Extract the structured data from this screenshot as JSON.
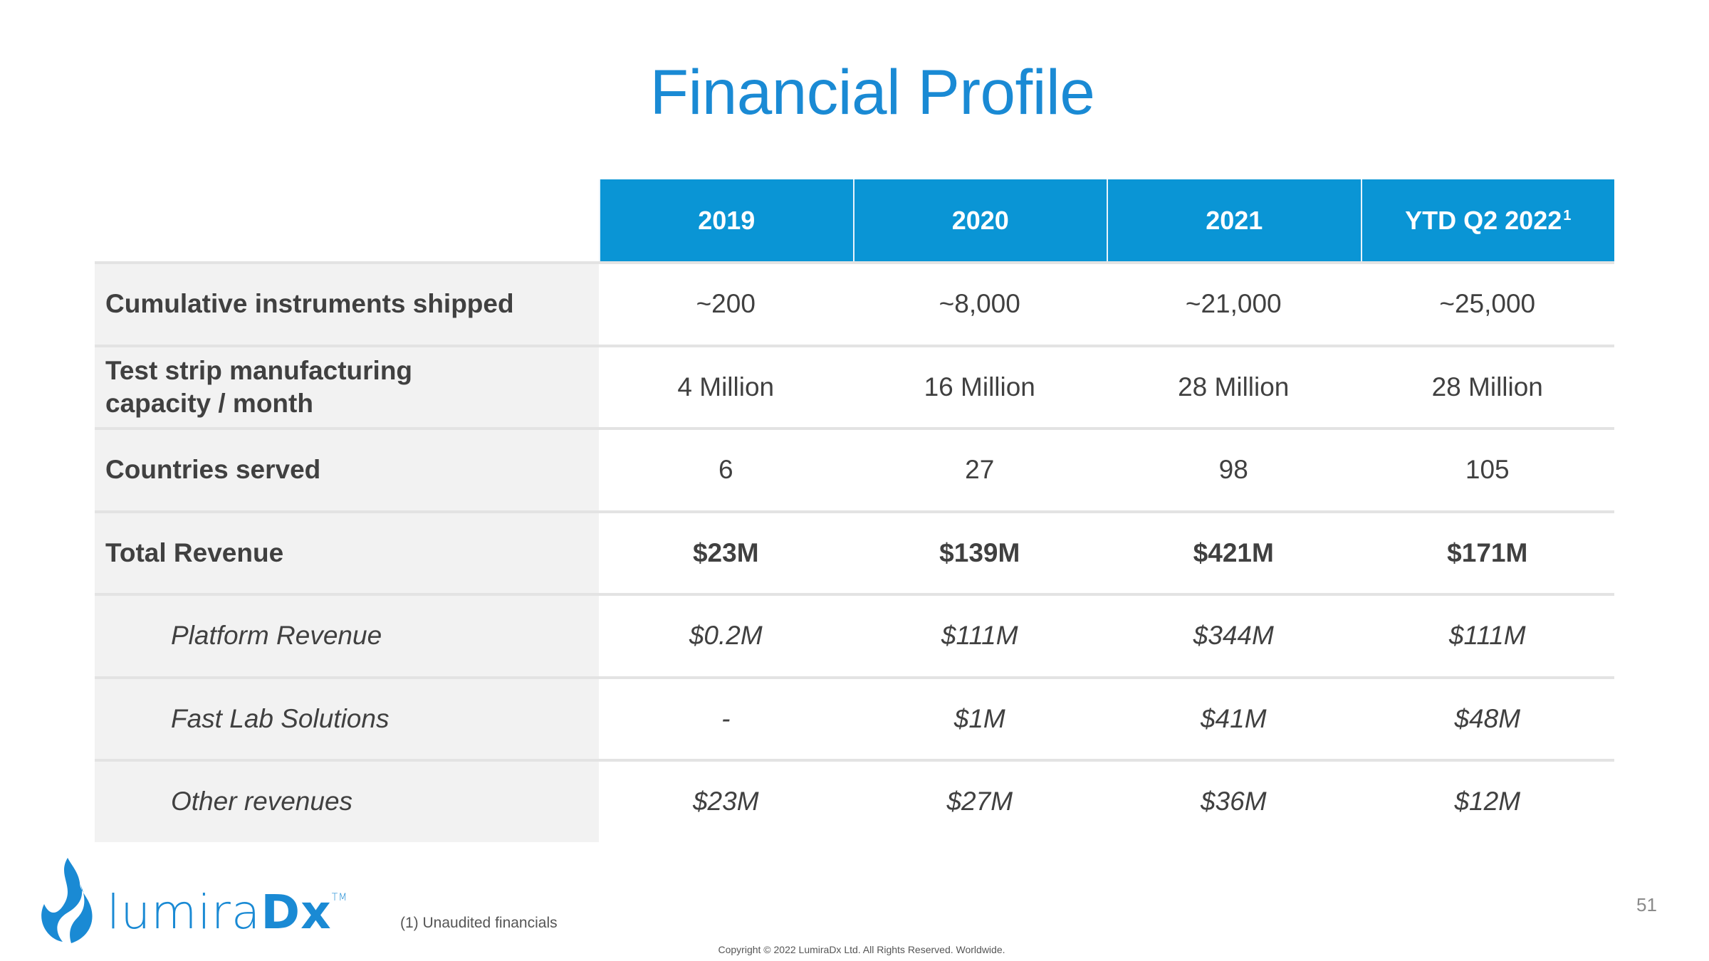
{
  "title": "Financial Profile",
  "table": {
    "columns": [
      {
        "label": "2019",
        "sup": ""
      },
      {
        "label": "2020",
        "sup": ""
      },
      {
        "label": "2021",
        "sup": ""
      },
      {
        "label": "YTD Q2 2022",
        "sup": "1"
      }
    ],
    "rows": [
      {
        "label": "Cumulative instruments shipped",
        "style": "bold-label",
        "values": [
          "~200",
          "~8,000",
          "~21,000",
          "~25,000"
        ]
      },
      {
        "label": "Test strip manufacturing capacity / month",
        "style": "bold-label",
        "values": [
          "4 Million",
          "16 Million",
          "28 Million",
          "28 Million"
        ]
      },
      {
        "label": "Countries served",
        "style": "bold-label",
        "values": [
          "6",
          "27",
          "98",
          "105"
        ]
      },
      {
        "label": "Total Revenue",
        "style": "bold",
        "values": [
          "$23M",
          "$139M",
          "$421M",
          "$171M"
        ]
      },
      {
        "label": "Platform Revenue",
        "style": "italic",
        "values": [
          "$0.2M",
          "$111M",
          "$344M",
          "$111M"
        ]
      },
      {
        "label": "Fast Lab Solutions",
        "style": "italic",
        "values": [
          "-",
          "$1M",
          "$41M",
          "$48M"
        ]
      },
      {
        "label": "Other revenues",
        "style": "italic",
        "values": [
          "$23M",
          "$27M",
          "$36M",
          "$12M"
        ]
      }
    ]
  },
  "logo": {
    "text_light": "lumira",
    "text_bold": "Dx",
    "trademark": "TM"
  },
  "footnote": "(1) Unaudited financials",
  "copyright": "Copyright © 2022 LumiraDx Ltd. All Rights Reserved. Worldwide.",
  "page_number": "51",
  "colors": {
    "brand_blue": "#1a8ad4",
    "header_blue": "#0a95d5",
    "label_bg": "#f2f2f2"
  }
}
